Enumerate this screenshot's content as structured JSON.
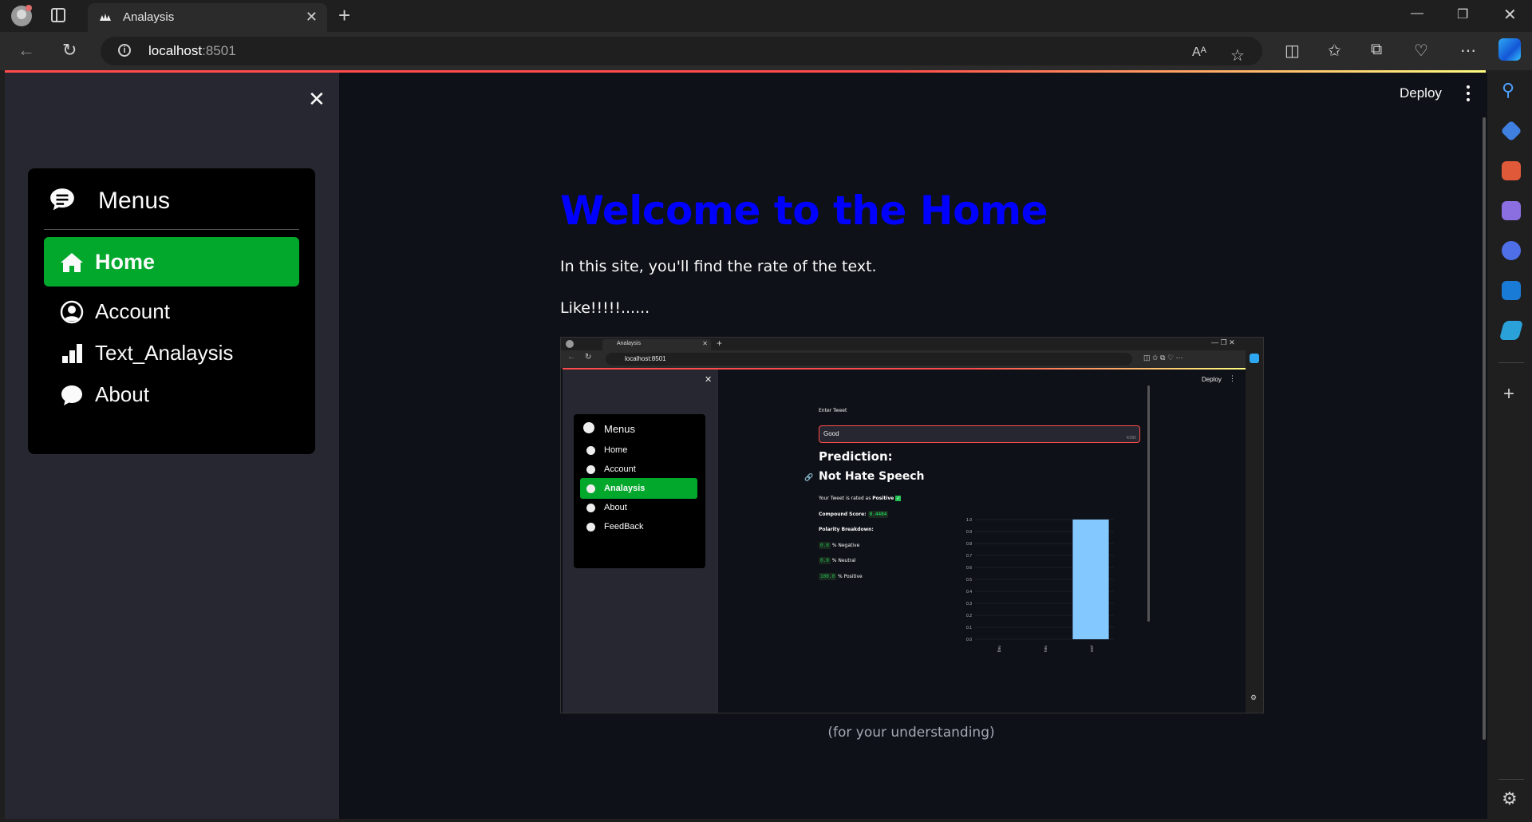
{
  "browser": {
    "tab_title": "Analaysis",
    "url_host": "localhost",
    "url_port": ":8501"
  },
  "sidebar": {
    "menu_title": "Menus",
    "items": [
      {
        "label": "Home",
        "icon": "house-icon",
        "active": true
      },
      {
        "label": "Account",
        "icon": "person-circle-icon",
        "active": false
      },
      {
        "label": "Text_Analaysis",
        "icon": "bar-chart-icon",
        "active": false
      },
      {
        "label": "About",
        "icon": "chat-bubble-icon",
        "active": false
      }
    ]
  },
  "header": {
    "deploy_label": "Deploy"
  },
  "main": {
    "title": "Welcome to the Home",
    "intro": "In this site, you'll find the rate of the text.",
    "like": "Like!!!!!......",
    "caption": "(for your understanding)"
  },
  "embedded_screenshot": {
    "tab_title": "Analaysis",
    "url": "localhost:8501",
    "deploy_label": "Deploy",
    "menu_title": "Menus",
    "menu_items": [
      {
        "label": "Home",
        "active": false
      },
      {
        "label": "Account",
        "active": false
      },
      {
        "label": "Analaysis",
        "active": true
      },
      {
        "label": "About",
        "active": false
      },
      {
        "label": "FeedBack",
        "active": false
      }
    ],
    "input_label": "Enter Tweet",
    "input_value": "Good",
    "input_counter": "4/280",
    "prediction_label": "Prediction:",
    "prediction_value": "Not Hate Speech",
    "rated_prefix": "Your Tweet is rated as",
    "rated_value": "Positive",
    "compound_label": "Compound Score:",
    "compound_value": "0.4404",
    "polarity_label": "Polarity Breakdown:",
    "neg_value": "0.0",
    "neg_label": "% Negative",
    "neu_value": "0.0",
    "neu_label": "% Neutral",
    "pos_value": "100.0",
    "pos_label": "% Positive",
    "chart_data": {
      "type": "bar",
      "categories": [
        "neg",
        "neu",
        "pos"
      ],
      "values": [
        0.0,
        0.0,
        1.0
      ],
      "yticks": [
        "0.0",
        "0.1",
        "0.2",
        "0.3",
        "0.4",
        "0.5",
        "0.6",
        "0.7",
        "0.8",
        "0.9",
        "1.0"
      ],
      "ylim": [
        0,
        1
      ],
      "bar_color": "#83c9ff"
    }
  },
  "colors": {
    "accent_green": "#02a82c",
    "title_blue": "#0000ff",
    "app_bg": "#0e1117",
    "sidebar_bg": "#262730"
  }
}
